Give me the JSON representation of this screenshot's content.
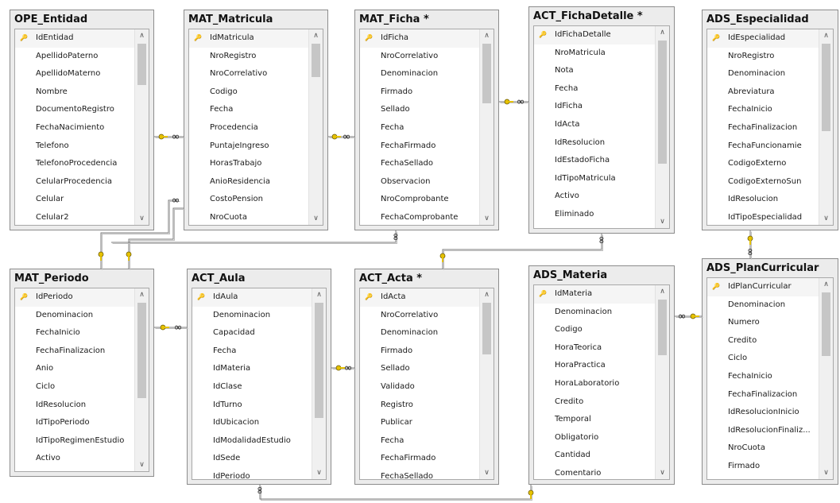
{
  "tables": [
    {
      "title": "OPE_Entidad",
      "columns": [
        "IdEntidad",
        "ApellidoPaterno",
        "ApellidoMaterno",
        "Nombre",
        "DocumentoRegistro",
        "FechaNacimiento",
        "Telefono",
        "TelefonoProcedencia",
        "CelularProcedencia",
        "Celular",
        "Celular2"
      ]
    },
    {
      "title": "MAT_Matricula",
      "columns": [
        "IdMatricula",
        "NroRegistro",
        "NroCorrelativo",
        "Codigo",
        "Fecha",
        "Procedencia",
        "PuntajeIngreso",
        "HorasTrabajo",
        "AnioResidencia",
        "CostoPension",
        "NroCuota"
      ]
    },
    {
      "title": "MAT_Ficha *",
      "columns": [
        "IdFicha",
        "NroCorrelativo",
        "Denominacion",
        "Firmado",
        "Sellado",
        "Fecha",
        "FechaFirmado",
        "FechaSellado",
        "Observacion",
        "NroComprobante",
        "FechaComprobante"
      ]
    },
    {
      "title": "ACT_FichaDetalle *",
      "columns": [
        "IdFichaDetalle",
        "NroMatricula",
        "Nota",
        "Fecha",
        "IdFicha",
        "IdActa",
        "IdResolucion",
        "IdEstadoFicha",
        "IdTipoMatricula",
        "Activo",
        "Eliminado"
      ]
    },
    {
      "title": "ADS_Especialidad",
      "columns": [
        "IdEspecialidad",
        "NroRegistro",
        "Denominacion",
        "Abreviatura",
        "FechaInicio",
        "FechaFinalizacion",
        "FechaFuncionamie",
        "CodigoExterno",
        "CodigoExternoSun",
        "IdResolucion",
        "IdTipoEspecialidad"
      ]
    },
    {
      "title": "MAT_Periodo",
      "columns": [
        "IdPeriodo",
        "Denominacion",
        "FechaInicio",
        "FechaFinalizacion",
        "Anio",
        "Ciclo",
        "IdResolucion",
        "IdTipoPeriodo",
        "IdTipoRegimenEstudio",
        "Activo"
      ]
    },
    {
      "title": "ACT_Aula",
      "columns": [
        "IdAula",
        "Denominacion",
        "Capacidad",
        "Fecha",
        "IdMateria",
        "IdClase",
        "IdTurno",
        "IdUbicacion",
        "IdModalidadEstudio",
        "IdSede",
        "IdPeriodo"
      ]
    },
    {
      "title": "ACT_Acta *",
      "columns": [
        "IdActa",
        "NroCorrelativo",
        "Denominacion",
        "Firmado",
        "Sellado",
        "Validado",
        "Registro",
        "Publicar",
        "Fecha",
        "FechaFirmado",
        "FechaSellado"
      ]
    },
    {
      "title": "ADS_Materia",
      "columns": [
        "IdMateria",
        "Denominacion",
        "Codigo",
        "HoraTeorica",
        "HoraPractica",
        "HoraLaboratorio",
        "Credito",
        "Temporal",
        "Obligatorio",
        "Cantidad",
        "Comentario"
      ]
    },
    {
      "title": "ADS_PlanCurricular",
      "columns": [
        "IdPlanCurricular",
        "Denominacion",
        "Numero",
        "Credito",
        "Ciclo",
        "FechaInicio",
        "FechaFinalizacion",
        "IdResolucionInicio",
        "IdResolucionFinaliz...",
        "NroCuota",
        "Firmado"
      ]
    }
  ],
  "icons": {
    "primary_key": "key-icon",
    "one_end": "key-icon",
    "many_end": "infinity-icon",
    "scroll_up": "chevron-up-icon",
    "scroll_down": "chevron-down-icon"
  },
  "colors": {
    "key": "#e6c200",
    "line": "#7a7a7a",
    "title_bg": "#ececec"
  }
}
